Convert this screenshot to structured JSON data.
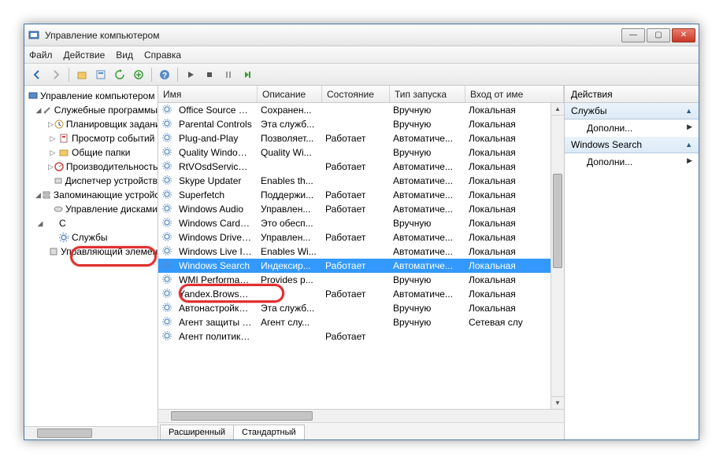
{
  "window": {
    "title": "Управление компьютером"
  },
  "menu": {
    "file": "Файл",
    "action": "Действие",
    "view": "Вид",
    "help": "Справка"
  },
  "tree": {
    "root": "Управление компьютером (л",
    "system_tools": "Служебные программы",
    "scheduler": "Планировщик заданий",
    "event_viewer": "Просмотр событий",
    "shared": "Общие папки",
    "perf": "Производительность",
    "devmgr": "Диспетчер устройств",
    "storage": "Запоминающие устройст",
    "diskmgmt": "Управление дисками",
    "services_apps_hidden": "С",
    "services": "Службы",
    "wmi": "Управляющий элемен"
  },
  "columns": {
    "name": "Имя",
    "desc": "Описание",
    "state": "Состояние",
    "start": "Тип запуска",
    "logon": "Вход от име"
  },
  "rows": [
    {
      "name": "Office Source Engi...",
      "desc": "Сохранен...",
      "state": "",
      "start": "Вручную",
      "logon": "Локальная"
    },
    {
      "name": "Parental Controls",
      "desc": "Эта служб...",
      "state": "",
      "start": "Вручную",
      "logon": "Локальная"
    },
    {
      "name": "Plug-and-Play",
      "desc": "Позволяет...",
      "state": "Работает",
      "start": "Автоматиче...",
      "logon": "Локальная"
    },
    {
      "name": "Quality Windows ...",
      "desc": "Quality Wi...",
      "state": "",
      "start": "Вручную",
      "logon": "Локальная"
    },
    {
      "name": "RtVOsdService Ins...",
      "desc": "",
      "state": "Работает",
      "start": "Автоматиче...",
      "logon": "Локальная"
    },
    {
      "name": "Skype Updater",
      "desc": "Enables th...",
      "state": "",
      "start": "Автоматиче...",
      "logon": "Локальная"
    },
    {
      "name": "Superfetch",
      "desc": "Поддержи...",
      "state": "Работает",
      "start": "Автоматиче...",
      "logon": "Локальная"
    },
    {
      "name": "Windows Audio",
      "desc": "Управлен...",
      "state": "Работает",
      "start": "Автоматиче...",
      "logon": "Локальная"
    },
    {
      "name": "Windows CardSpa...",
      "desc": "Это обесп...",
      "state": "",
      "start": "Вручную",
      "logon": "Локальная"
    },
    {
      "name": "Windows Driver F...",
      "desc": "Управлен...",
      "state": "Работает",
      "start": "Автоматиче...",
      "logon": "Локальная"
    },
    {
      "name": "Windows Live ID S...",
      "desc": "Enables Wi...",
      "state": "",
      "start": "Автоматиче...",
      "logon": "Локальная"
    },
    {
      "name": "Windows Search",
      "desc": "Индексир...",
      "state": "Работает",
      "start": "Автоматиче...",
      "logon": "Локальная",
      "selected": true
    },
    {
      "name": "WMI Performance...",
      "desc": "Provides p...",
      "state": "",
      "start": "Вручную",
      "logon": "Локальная"
    },
    {
      "name": "Yandex.Browser U...",
      "desc": "",
      "state": "Работает",
      "start": "Автоматиче...",
      "logon": "Локальная"
    },
    {
      "name": "Автонастройка W...",
      "desc": "Эта служб...",
      "state": "",
      "start": "Вручную",
      "logon": "Локальная"
    },
    {
      "name": "Агент защиты сет...",
      "desc": "Агент слу...",
      "state": "",
      "start": "Вручную",
      "logon": "Сетевая слу"
    },
    {
      "name": "Агент политики I...",
      "desc": "",
      "state": "Работает",
      "start": "",
      "logon": ""
    }
  ],
  "tabs": {
    "extended": "Расширенный",
    "standard": "Стандартный"
  },
  "actions": {
    "title": "Действия",
    "section1": "Службы",
    "more1": "Дополни...",
    "section2": "Windows Search",
    "more2": "Дополни..."
  }
}
